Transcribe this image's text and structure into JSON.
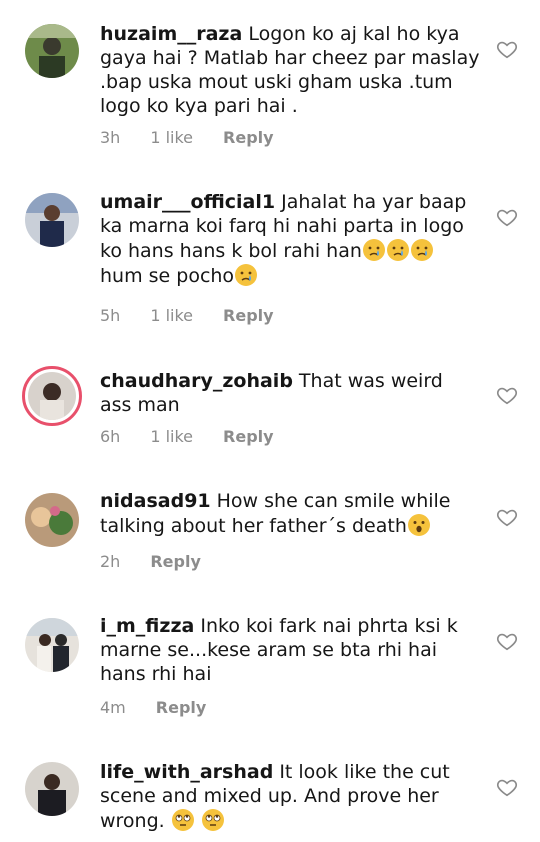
{
  "comments": [
    {
      "username": "huzaim__raza",
      "text": "Logon ko aj kal ho kya gaya hai ? Matlab har cheez par maslay .bap uska mout uski gham uska .tum logo ko kya pari hai .",
      "time": "3h",
      "likes": "1 like",
      "reply": "Reply"
    },
    {
      "username": "umair___official1",
      "text": "Jahalat ha yar baap ka marna koi farq hi nahi parta in logo ko hans hans k bol rahi han",
      "text2": "hum se pocho",
      "time": "5h",
      "likes": "1 like",
      "reply": "Reply"
    },
    {
      "username": "chaudhary_zohaib",
      "text": "That was weird ass man",
      "time": "6h",
      "likes": "1 like",
      "reply": "Reply"
    },
    {
      "username": "nidasad91",
      "text": "How she can smile while talking about her father´s death",
      "time": "2h",
      "reply": "Reply"
    },
    {
      "username": "i_m_fizza",
      "text": "Inko koi fark nai phrta ksi k marne se...kese aram se bta rhi hai hans rhi hai",
      "time": "4m",
      "reply": "Reply"
    },
    {
      "username": "life_with_arshad",
      "text": "It look like the cut scene and mixed up. And prove her wrong.",
      "time": "",
      "reply": ""
    }
  ],
  "icons": {
    "like": "heart-outline-icon",
    "cry_emoji": "crying-face-emoji",
    "surprised_emoji": "surprised-face-emoji",
    "eyeroll_emoji": "eye-roll-emoji"
  },
  "colors": {
    "story_ring": "#e8506b",
    "meta_text": "#8c8c8c"
  }
}
